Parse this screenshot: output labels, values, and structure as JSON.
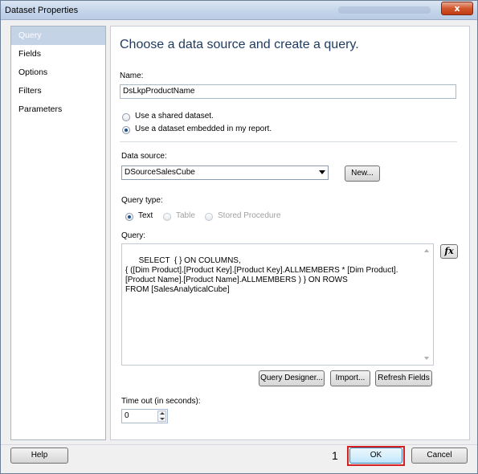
{
  "window": {
    "title": "Dataset Properties",
    "close_label": "x"
  },
  "nav": {
    "items": [
      {
        "label": "Query",
        "selected": true
      },
      {
        "label": "Fields",
        "selected": false
      },
      {
        "label": "Options",
        "selected": false
      },
      {
        "label": "Filters",
        "selected": false
      },
      {
        "label": "Parameters",
        "selected": false
      }
    ]
  },
  "main": {
    "heading": "Choose a data source and create a query.",
    "name_label": "Name:",
    "name_value": "DsLkpProductName",
    "radio_shared": "Use a shared dataset.",
    "radio_embedded": "Use a dataset embedded in my report.",
    "embedded_selected": true,
    "datasource_label": "Data source:",
    "datasource_value": "DSourceSalesCube",
    "new_button": "New...",
    "querytype_label": "Query type:",
    "querytype_options": [
      "Text",
      "Table",
      "Stored Procedure"
    ],
    "querytype_selected": "Text",
    "query_label": "Query:",
    "query_text": "SELECT  { } ON COLUMNS,\n{ ([Dim Product].[Product Key].[Product Key].ALLMEMBERS * [Dim Product].[Product Name].[Product Name].ALLMEMBERS ) } ON ROWS\nFROM [SalesAnalyticalCube]",
    "fx_label": "fx",
    "query_designer_button": "Query Designer...",
    "import_button": "Import...",
    "refresh_button": "Refresh Fields",
    "timeout_label": "Time out (in seconds):",
    "timeout_value": "0"
  },
  "footer": {
    "help_button": "Help",
    "step_marker": "1",
    "ok_button": "OK",
    "cancel_button": "Cancel"
  },
  "colors": {
    "highlight": "#d42020",
    "heading": "#1e3a5f",
    "nav_selected": "#c5d3e6"
  }
}
